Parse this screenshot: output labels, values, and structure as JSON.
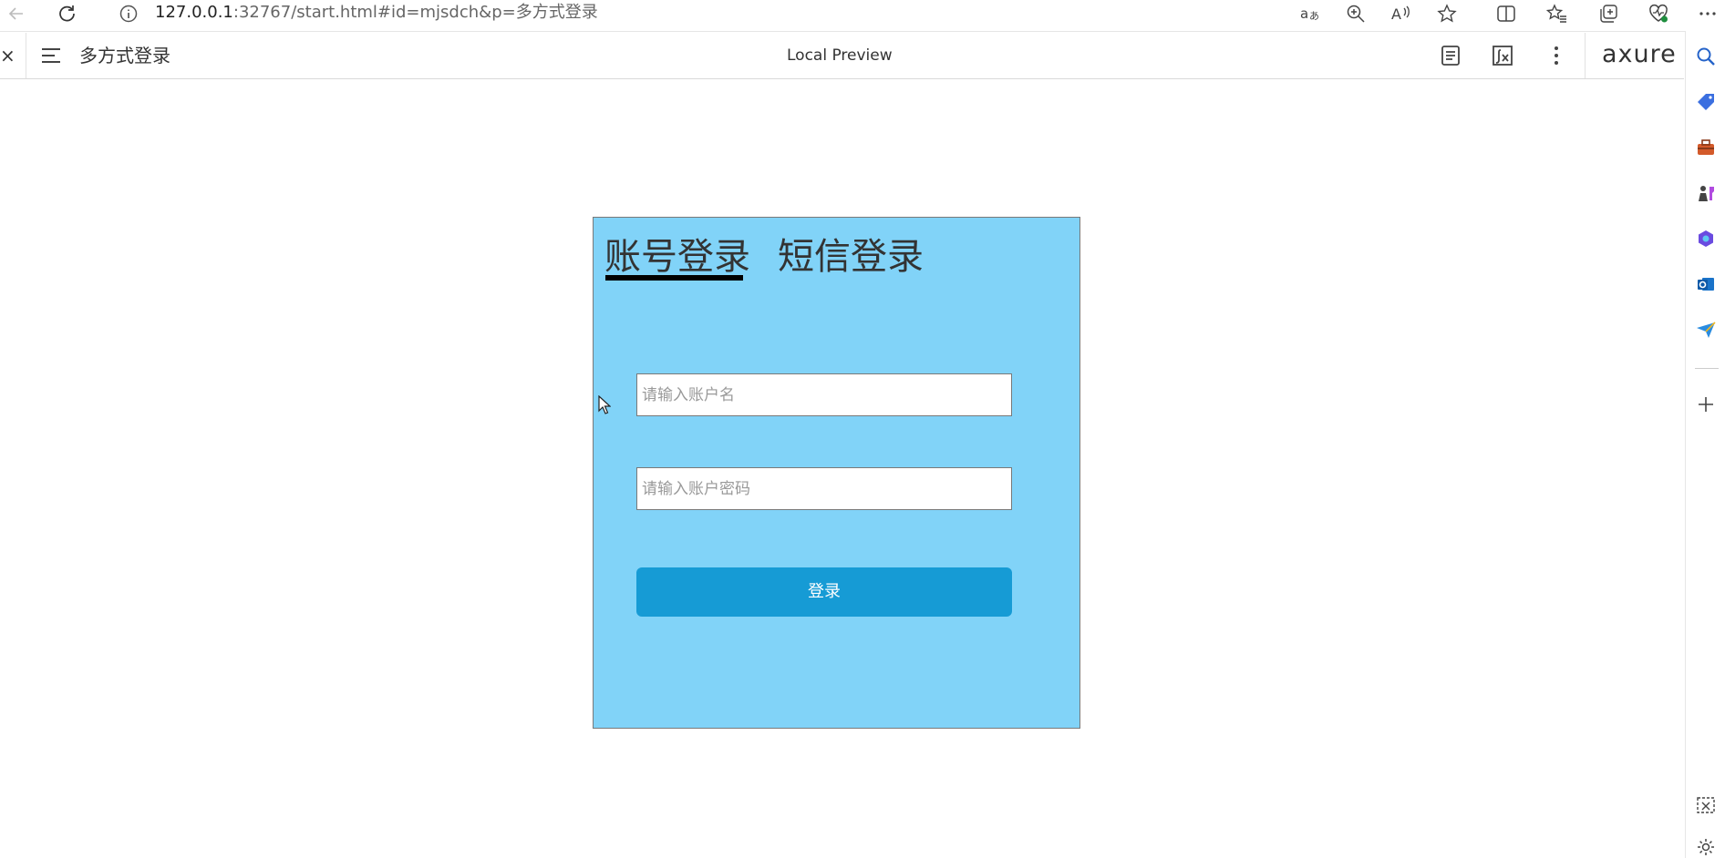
{
  "browser": {
    "url_host": "127.0.0.1",
    "url_rest": ":32767/start.html#id=mjsdch&p=多方式登录"
  },
  "axure_toolbar": {
    "close_glyph": "×",
    "page_name": "多方式登录",
    "preview_label": "Local Preview",
    "logo_text": "axure"
  },
  "login": {
    "tabs": [
      {
        "label": "账号登录",
        "active": true
      },
      {
        "label": "短信登录",
        "active": false
      }
    ],
    "username_placeholder": "请输入账户名",
    "password_placeholder": "请输入账户密码",
    "button_label": "登录"
  },
  "colors": {
    "panel_bg": "#81d3f8",
    "button_bg": "#169bd5",
    "tab_underline": "#000000"
  },
  "icons": {
    "browser": [
      "back-arrow-icon",
      "refresh-icon",
      "site-info-icon",
      "read-aloud-translate-icon",
      "zoom-icon",
      "read-aloud-icon",
      "favorite-star-icon",
      "split-screen-icon",
      "favorites-icon",
      "collections-icon",
      "browser-essentials-icon",
      "more-dots-icon"
    ],
    "toolbar": [
      "close-icon",
      "hamburger-menu-icon",
      "notes-icon",
      "variables-icon",
      "more-vertical-icon"
    ],
    "sidebar": [
      "search-icon",
      "tag-icon",
      "toolbox-icon",
      "games-icon",
      "copilot-icon",
      "outlook-icon",
      "send-icon",
      "add-icon",
      "screenshot-icon",
      "settings-icon"
    ]
  }
}
